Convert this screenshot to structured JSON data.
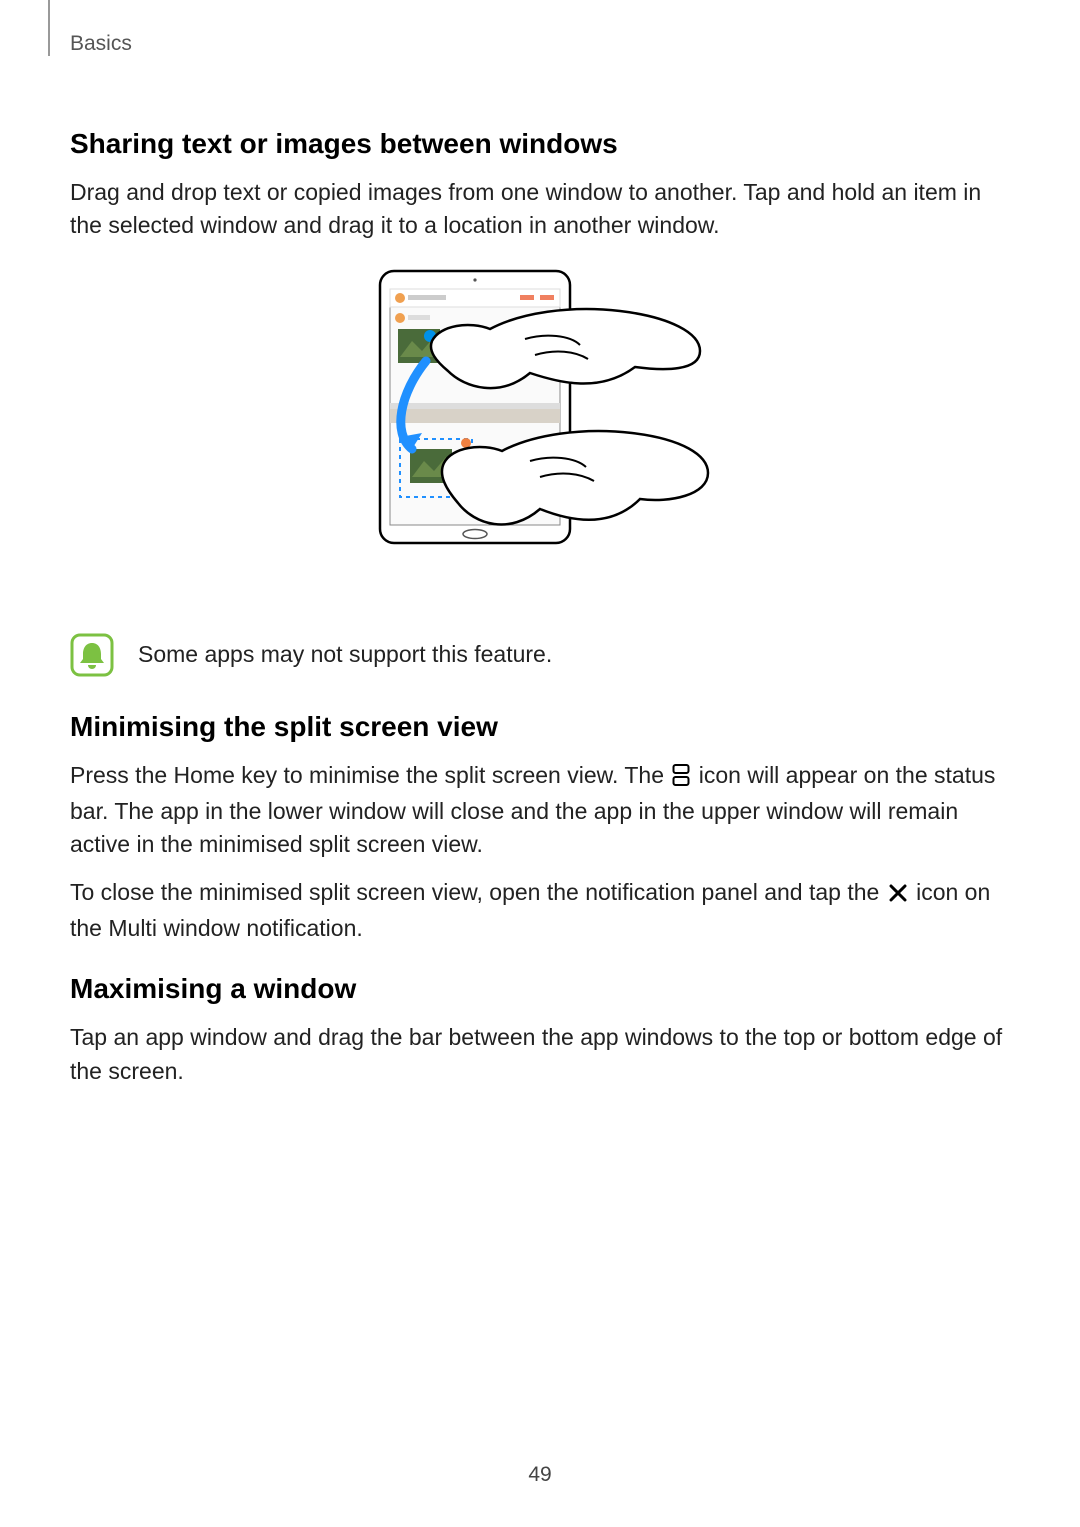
{
  "breadcrumb": "Basics",
  "section1": {
    "heading": "Sharing text or images between windows",
    "body": "Drag and drop text or copied images from one window to another. Tap and hold an item in the selected window and drag it to a location in another window."
  },
  "note": {
    "text": "Some apps may not support this feature."
  },
  "section2": {
    "heading": "Minimising the split screen view",
    "body_a": "Press the Home key to minimise the split screen view. The ",
    "body_b": " icon will appear on the status bar. The app in the lower window will close and the app in the upper window will remain active in the minimised split screen view.",
    "body_c": "To close the minimised split screen view, open the notification panel and tap the ",
    "body_d": " icon on the Multi window notification."
  },
  "section3": {
    "heading": "Maximising a window",
    "body": "Tap an app window and drag the bar between the app windows to the top or bottom edge of the screen."
  },
  "page_number": "49"
}
